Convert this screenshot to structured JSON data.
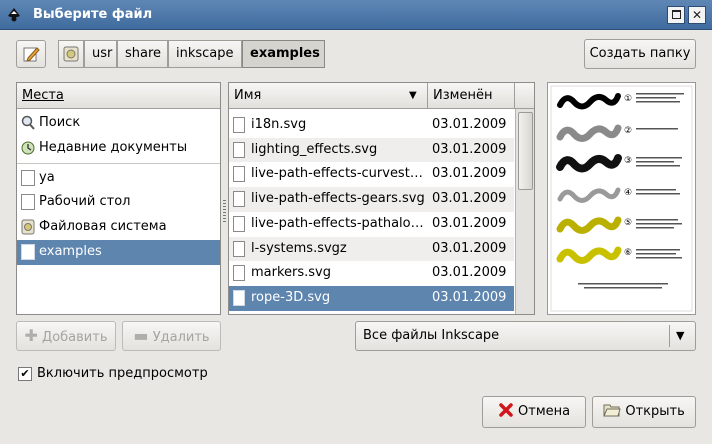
{
  "window": {
    "title": "Выберите файл"
  },
  "toolbar": {
    "breadcrumbs": [
      "usr",
      "share",
      "inkscape",
      "examples"
    ],
    "create_folder_label": "Создать папку"
  },
  "places": {
    "header": "Места",
    "items": [
      {
        "label": "Поиск",
        "icon": "search-icon"
      },
      {
        "label": "Недавние документы",
        "icon": "recent-icon"
      },
      {
        "label": "ya",
        "icon": "document-icon"
      },
      {
        "label": "Рабочий стол",
        "icon": "document-icon"
      },
      {
        "label": "Файловая система",
        "icon": "drive-icon"
      },
      {
        "label": "examples",
        "icon": "document-icon"
      }
    ],
    "selected": "examples"
  },
  "files": {
    "col_name": "Имя",
    "col_modified": "Изменён",
    "rows": [
      {
        "name": "i18n.svg",
        "date": "03.01.2009"
      },
      {
        "name": "lighting_effects.svg",
        "date": "03.01.2009"
      },
      {
        "name": "live-path-effects-curvestitch.svg",
        "date": "03.01.2009"
      },
      {
        "name": "live-path-effects-gears.svg",
        "date": "03.01.2009"
      },
      {
        "name": "live-path-effects-pathalongpath.svg",
        "date": "03.01.2009"
      },
      {
        "name": "l-systems.svgz",
        "date": "03.01.2009"
      },
      {
        "name": "markers.svg",
        "date": "03.01.2009"
      },
      {
        "name": "rope-3D.svg",
        "date": "03.01.2009"
      }
    ],
    "selected": "rope-3D.svg"
  },
  "preview": {
    "numbers": [
      "①",
      "②",
      "③",
      "④",
      "⑤",
      "⑥"
    ]
  },
  "actions": {
    "add_label": "Добавить",
    "remove_label": "Удалить",
    "filter_value": "Все файлы Inkscape",
    "preview_checkbox_label": "Включить предпросмотр",
    "cancel_label": "Отмена",
    "open_label": "Открыть"
  },
  "colors": {
    "selection": "#5d85ae",
    "titlebar": "#4a76a8"
  }
}
